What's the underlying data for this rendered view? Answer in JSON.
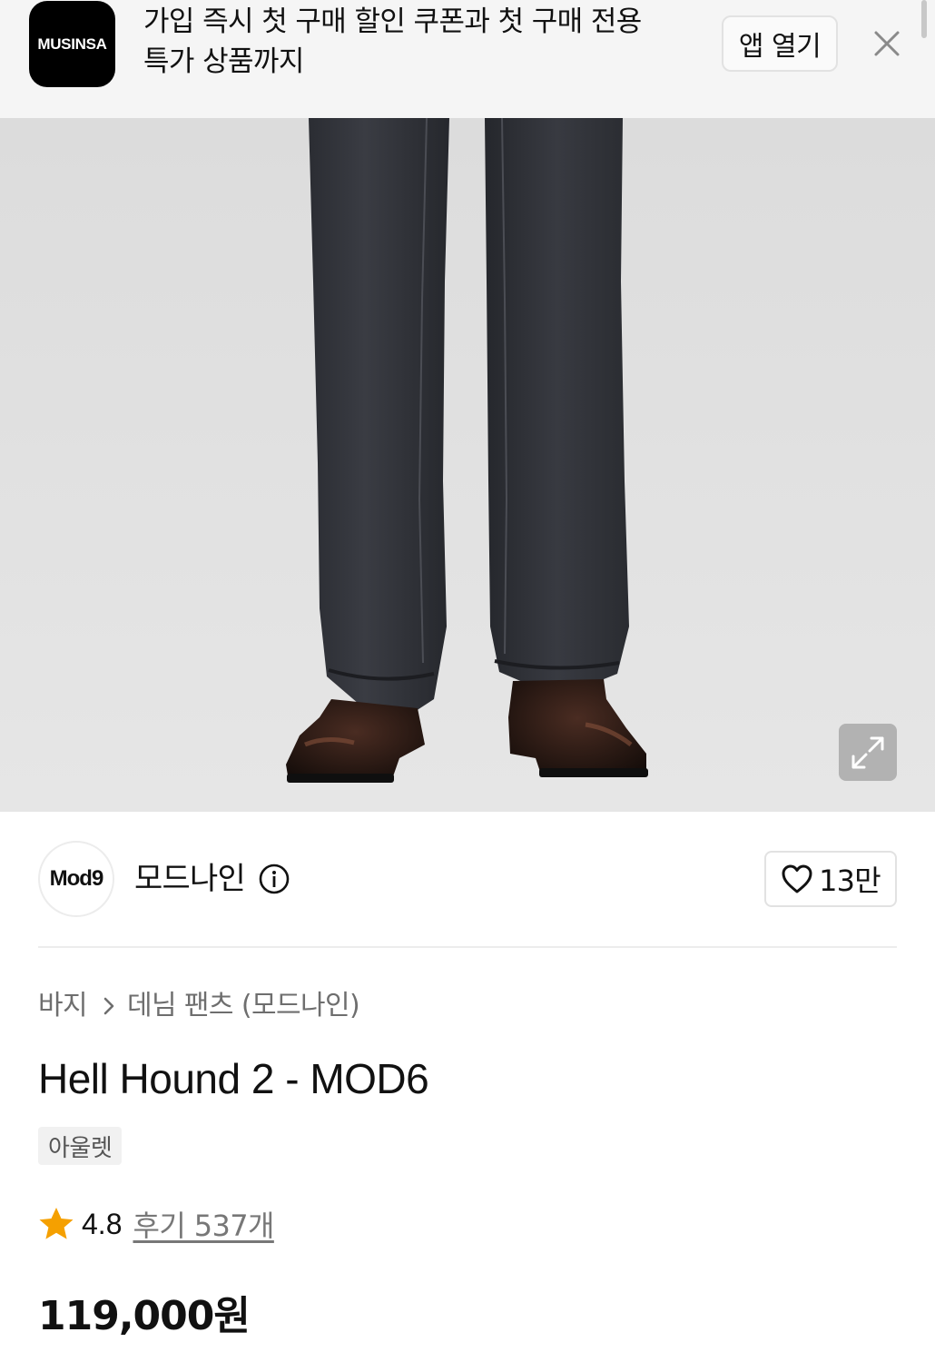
{
  "app_banner": {
    "logo_text": "MUSINSA",
    "message_line1": "가입 즉시 첫 구매 할인 쿠폰과 첫 구매 전용",
    "message_line2": "특가 상품까지",
    "open_app_label": "앱 열기",
    "close_icon": "close-icon"
  },
  "product_image": {
    "expand_icon": "expand-icon"
  },
  "brand": {
    "avatar_text": "Mod9",
    "name": "모드나인",
    "info_icon": "info-icon",
    "like_count": "13만",
    "like_icon": "heart-icon"
  },
  "product": {
    "breadcrumb": [
      "바지",
      "데님 팬츠 (모드나인)"
    ],
    "title": "Hell Hound 2 - MOD6",
    "badge": "아울렛",
    "rating": "4.8",
    "review_label": "후기 537개",
    "price": "119,000원"
  },
  "colors": {
    "star": "#f5a000",
    "banner_bg": "#f5f5f5",
    "image_bg": "#e1e1e1",
    "muted_text": "#6e6e6e"
  }
}
